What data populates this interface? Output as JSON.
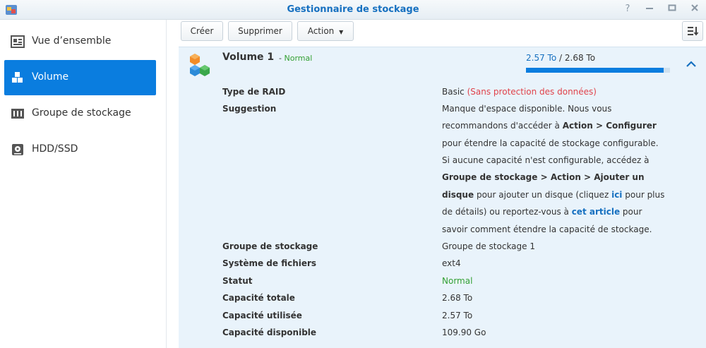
{
  "window": {
    "title": "Gestionnaire de stockage"
  },
  "sidebar": {
    "items": [
      {
        "label": "Vue d’ensemble"
      },
      {
        "label": "Volume"
      },
      {
        "label": "Groupe de stockage"
      },
      {
        "label": "HDD/SSD"
      }
    ]
  },
  "toolbar": {
    "create": "Créer",
    "delete": "Supprimer",
    "action": "Action"
  },
  "volume": {
    "name": "Volume 1",
    "status_prefix": "-",
    "status": "Normal",
    "used": "2.57 To",
    "separator": "/",
    "total": "2.68 To",
    "usage_fraction": 0.958
  },
  "details": {
    "raid_label": "Type de RAID",
    "raid_value": "Basic",
    "raid_warning": "(Sans protection des données)",
    "suggestion_label": "Suggestion",
    "suggestion": {
      "l1": "Manque d'espace disponible. Nous vous",
      "l2_a": "recommandons d'accéder à",
      "l2_b": "Action > Configurer",
      "l3": "pour étendre la capacité de stockage configurable.",
      "l4": "Si aucune capacité n'est configurable, accédez à",
      "l5": "Groupe de stockage > Action > Ajouter un",
      "l6_a": "disque",
      "l6_b": "pour ajouter un disque (cliquez",
      "l6_link": "ici",
      "l6_c": "pour plus",
      "l7_a": "de détails) ou reportez-vous à",
      "l7_link": "cet article",
      "l7_b": "pour",
      "l8": "savoir comment étendre la capacité de stockage."
    },
    "pool_label": "Groupe de stockage",
    "pool_value": "Groupe de stockage 1",
    "fs_label": "Système de fichiers",
    "fs_value": "ext4",
    "status_label": "Statut",
    "status_value": "Normal",
    "total_label": "Capacité totale",
    "total_value": "2.68 To",
    "used_label": "Capacité utilisée",
    "used_value": "2.57 To",
    "free_label": "Capacité disponible",
    "free_value": "109.90 Go"
  },
  "colors": {
    "accent": "#0a7ddf",
    "ok": "#33a033",
    "warn": "#e0424a",
    "panel": "#e9f3fb"
  }
}
